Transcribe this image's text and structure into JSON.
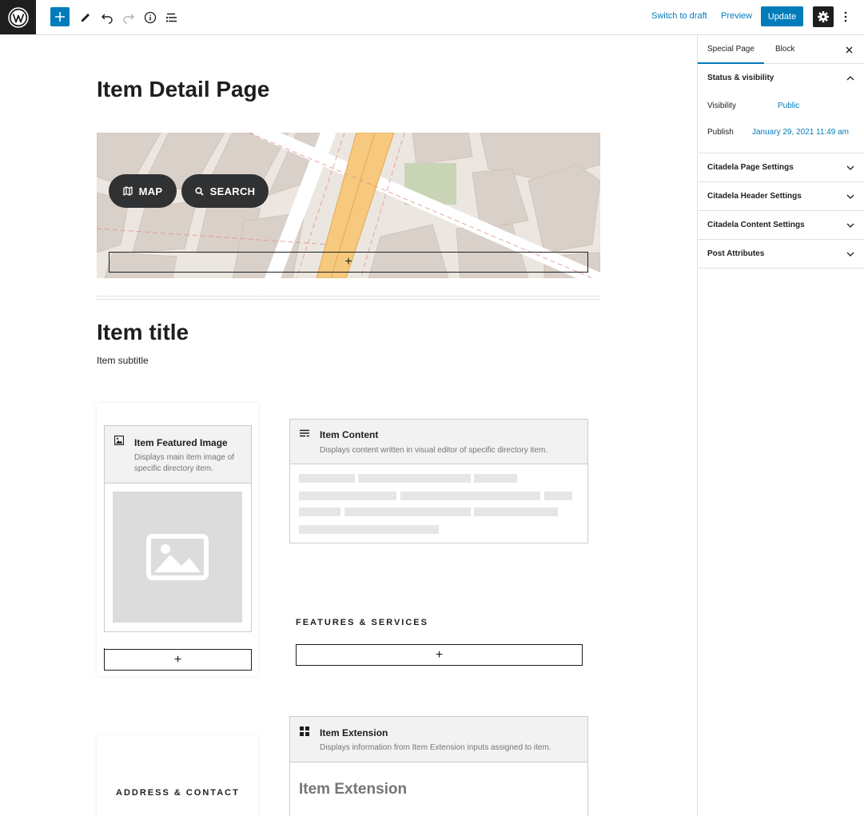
{
  "toolbar": {
    "switch_to_draft": "Switch to draft",
    "preview": "Preview",
    "update": "Update",
    "add_icon": "plus-icon",
    "tool_icons": [
      "wordpress-logo",
      "pencil-icon",
      "undo-icon",
      "redo-icon",
      "info-icon",
      "list-view-icon",
      "gear-icon",
      "more-vertical-icon"
    ]
  },
  "editor": {
    "page_title": "Item Detail Page",
    "map": {
      "map_button": "MAP",
      "search_button": "SEARCH"
    },
    "item_title": "Item title",
    "item_subtitle": "Item subtitle",
    "featured_image": {
      "title": "Item Featured Image",
      "description": "Displays main item image of specific directory item."
    },
    "item_content": {
      "title": "Item Content",
      "description": "Displays content written in visual editor of specific directory item."
    },
    "features_label": "FEATURES & SERVICES",
    "item_extension": {
      "title": "Item Extension",
      "description": "Displays information from Item Extension inputs assigned to item.",
      "preview_heading": "Item Extension"
    },
    "address_label": "ADDRESS & CONTACT",
    "appender_symbol": "+"
  },
  "sidebar": {
    "tabs": [
      "Special Page",
      "Block"
    ],
    "close_symbol": "×",
    "status_panel": {
      "title": "Status & visibility",
      "visibility_label": "Visibility",
      "visibility_value": "Public",
      "publish_label": "Publish",
      "publish_value": "January 29, 2021 11:49 am"
    },
    "panels": [
      "Citadela Page Settings",
      "Citadela Header Settings",
      "Citadela Content Settings",
      "Post Attributes"
    ]
  },
  "colors": {
    "accent": "#007cba",
    "dark": "#1e1e1e",
    "map_road": "#f7c97e",
    "map_park": "#c9d4b6"
  }
}
